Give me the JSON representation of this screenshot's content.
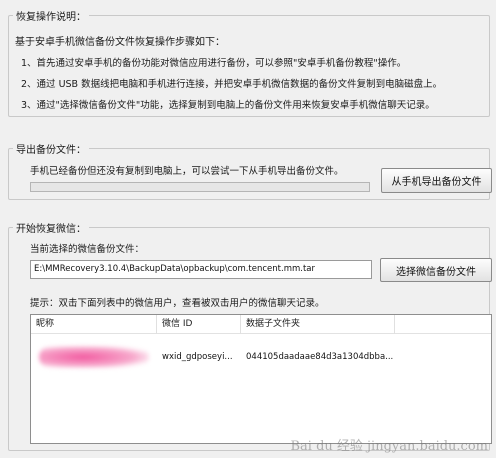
{
  "restore_info": {
    "title": "恢复操作说明：",
    "intro": "基于安卓手机微信备份文件恢复操作步骤如下：",
    "steps": [
      "1、首先通过安卓手机的备份功能对微信应用进行备份，可以参照\"安卓手机备份教程\"操作。",
      "2、通过 USB 数据线把电脑和手机进行连接，并把安卓手机微信数据的备份文件复制到电脑磁盘上。",
      "3、通过\"选择微信备份文件\"功能，选择复制到电脑上的备份文件用来恢复安卓手机微信聊天记录。"
    ]
  },
  "export_backup": {
    "title": "导出备份文件：",
    "message": "手机已经备份但还没有复制到电脑上，可以尝试一下从手机导出备份文件。",
    "progress": 0,
    "button_label": "从手机导出备份文件"
  },
  "start_restore": {
    "title": "开始恢复微信：",
    "current_label": "当前选择的微信备份文件：",
    "file_path": "E:\\MMRecovery3.10.4\\BackupData\\opbackup\\com.tencent.mm.tar",
    "select_button_label": "选择微信备份文件",
    "hint": "提示：双击下面列表中的微信用户，查看被双击用户的微信聊天记录。",
    "table": {
      "columns": [
        "昵称",
        "微信 ID",
        "数据子文件夹"
      ],
      "rows": [
        {
          "nickname": "",
          "wechat_id": "wxid_gdposeyi...",
          "data_folder": "044105daadaae84d3a1304dbba..."
        }
      ]
    }
  },
  "watermark": "Bai du 经验 jingyan.baidu.com"
}
